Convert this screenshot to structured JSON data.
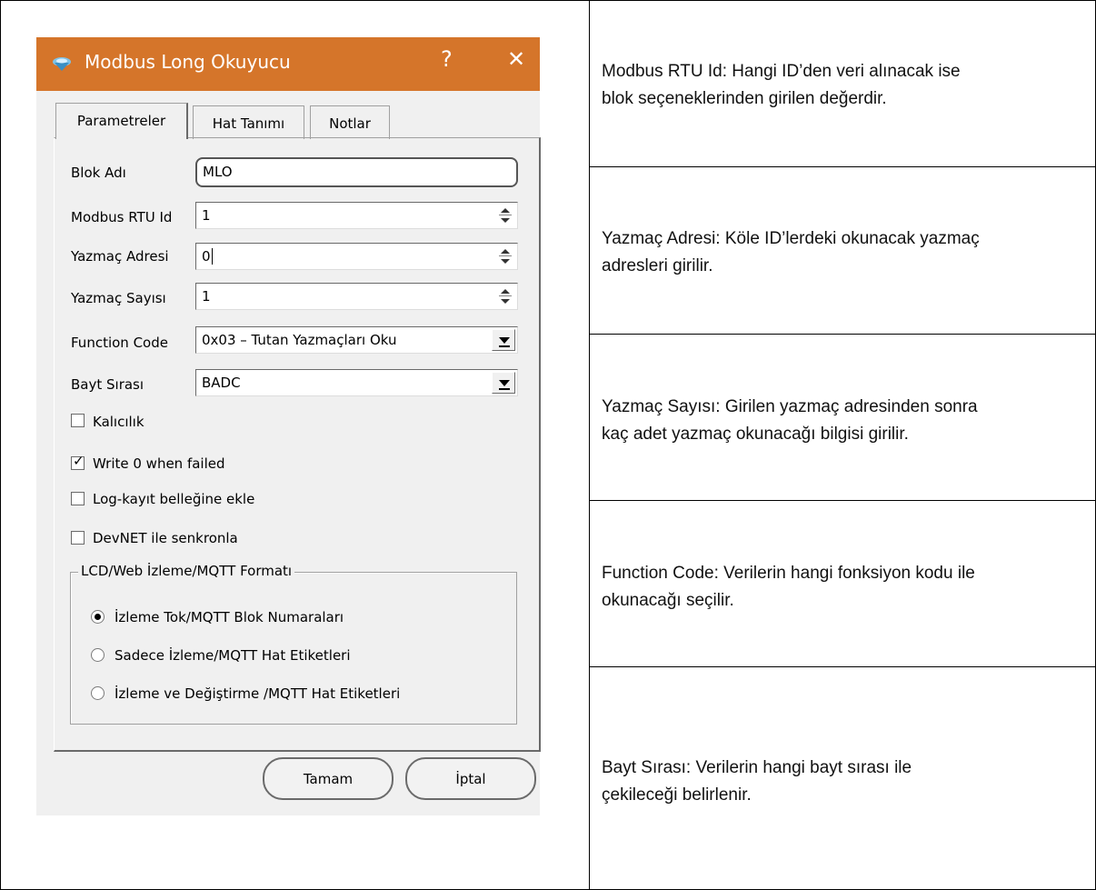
{
  "dialog": {
    "title": "Modbus Long Okuyucu",
    "help_glyph": "?",
    "close_glyph": "✕",
    "tabs": [
      {
        "label": "Parametreler"
      },
      {
        "label": "Hat Tanımı"
      },
      {
        "label": "Notlar"
      }
    ],
    "fields": {
      "blok_adi": {
        "label": "Blok Adı",
        "value": "MLO"
      },
      "rtu_id": {
        "label": "Modbus RTU Id",
        "value": "1"
      },
      "yazmac_adresi": {
        "label": "Yazmaç Adresi",
        "value": "0"
      },
      "yazmac_sayisi": {
        "label": "Yazmaç Sayısı",
        "value": "1"
      },
      "function_code": {
        "label": "Function Code",
        "value": "0x03 – Tutan Yazmaçları Oku"
      },
      "bayt_sirasi": {
        "label": "Bayt Sırası",
        "value": "BADC"
      }
    },
    "checkboxes": [
      {
        "label": "Kalıcılık",
        "checked": false
      },
      {
        "label": "Write 0 when failed",
        "checked": true
      },
      {
        "label": "Log-kayıt belleğine ekle",
        "checked": false
      },
      {
        "label": "DevNET ile senkronla",
        "checked": false
      }
    ],
    "group": {
      "title": "LCD/Web İzleme/MQTT Formatı",
      "options": [
        {
          "label": "İzleme Tok/MQTT Blok Numaraları",
          "selected": true
        },
        {
          "label": "Sadece İzleme/MQTT Hat Etiketleri",
          "selected": false
        },
        {
          "label": "İzleme ve Değiştirme /MQTT Hat Etiketleri",
          "selected": false
        }
      ]
    },
    "buttons": {
      "ok": "Tamam",
      "cancel": "İptal"
    }
  },
  "descriptions": [
    {
      "line1": "Modbus RTU Id:  Hangi ID’den veri alınacak ise",
      "line2": "blok seçeneklerinden girilen değerdir."
    },
    {
      "line1": "Yazmaç Adresi:  Köle ID’lerdeki okunacak yazmaç",
      "line2": "adresleri girilir."
    },
    {
      "line1": "Yazmaç Sayısı:  Girilen yazmaç adresinden sonra",
      "line2": "kaç adet yazmaç okunacağı bilgisi girilir."
    },
    {
      "line1": "Function Code:  Verilerin hangi fonksiyon kodu ile",
      "line2": "okunacağı seçilir."
    },
    {
      "line1": "Bayt Sırası:  Verilerin hangi bayt sırası ile",
      "line2": "çekileceği belirlenir."
    }
  ],
  "colors": {
    "titlebar": "#d5752a",
    "dialog_bg": "#f0f0f0"
  }
}
